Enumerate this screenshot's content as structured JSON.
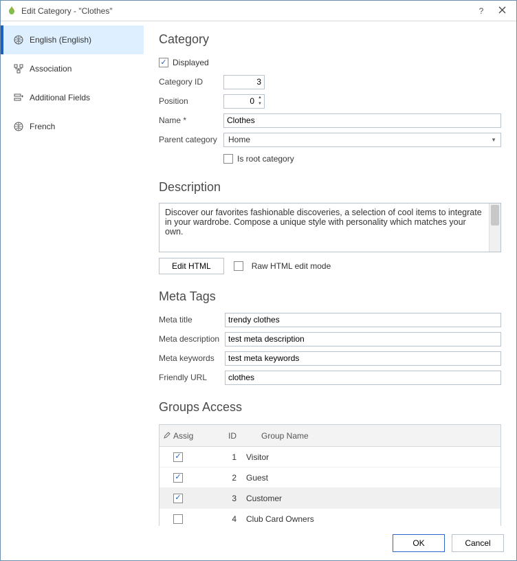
{
  "window": {
    "title": "Edit Category - \"Clothes\"",
    "help": "?",
    "close": "✕"
  },
  "sidebar": {
    "items": [
      {
        "label": "English (English)",
        "icon": "globe-icon",
        "active": true
      },
      {
        "label": "Association",
        "icon": "assoc-icon",
        "active": false
      },
      {
        "label": "Additional Fields",
        "icon": "fields-icon",
        "active": false
      },
      {
        "label": "French",
        "icon": "globe-icon",
        "active": false
      }
    ]
  },
  "sections": {
    "category": "Category",
    "description": "Description",
    "meta": "Meta Tags",
    "groups": "Groups Access"
  },
  "category": {
    "displayed_label": "Displayed",
    "displayed": true,
    "category_id_label": "Category ID",
    "category_id": "3",
    "position_label": "Position",
    "position": "0",
    "name_label": "Name *",
    "name": "Clothes",
    "parent_label": "Parent category",
    "parent": "Home",
    "is_root_label": "Is root category",
    "is_root": false
  },
  "description": {
    "text": "Discover our favorites fashionable discoveries, a selection of cool items to integrate in your wardrobe. Compose a unique style with personality which matches your own.",
    "edit_html_label": "Edit HTML",
    "raw_mode_label": "Raw HTML edit mode",
    "raw_mode": false
  },
  "meta": {
    "title_label": "Meta title",
    "title": "trendy clothes",
    "desc_label": "Meta description",
    "desc": "test meta description",
    "keywords_label": "Meta keywords",
    "keywords": "test meta keywords",
    "url_label": "Friendly URL",
    "url": "clothes"
  },
  "groups": {
    "headers": {
      "assig": "Assig",
      "id": "ID",
      "name": "Group Name"
    },
    "rows": [
      {
        "assig": true,
        "id": "1",
        "name": "Visitor",
        "selected": false
      },
      {
        "assig": true,
        "id": "2",
        "name": "Guest",
        "selected": false
      },
      {
        "assig": true,
        "id": "3",
        "name": "Customer",
        "selected": true
      },
      {
        "assig": false,
        "id": "4",
        "name": "Club Card Owners",
        "selected": false
      }
    ]
  },
  "footer": {
    "ok": "OK",
    "cancel": "Cancel"
  }
}
